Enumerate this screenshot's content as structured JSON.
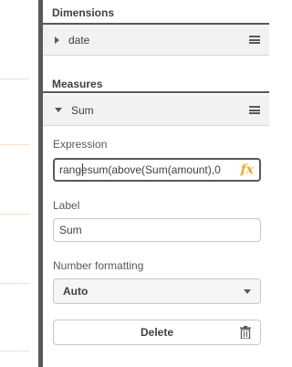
{
  "dimensions": {
    "title": "Dimensions",
    "items": [
      {
        "label": "date"
      }
    ]
  },
  "measures": {
    "title": "Measures",
    "items": [
      {
        "label": "Sum"
      }
    ]
  },
  "expression": {
    "label": "Expression",
    "value": "rangesum(above(Sum(amount),0",
    "fx_icon": "fx"
  },
  "label_field": {
    "label": "Label",
    "value": "Sum"
  },
  "number_formatting": {
    "label": "Number formatting",
    "selected": "Auto"
  },
  "delete_button": {
    "label": "Delete"
  },
  "colors": {
    "accent_fx": "#f5a623",
    "panel_rule": "#595959",
    "header_bg": "#f2f2f2"
  },
  "icons": [
    "hamburger-menu-icon",
    "caret-right-icon",
    "caret-down-icon",
    "fx-icon",
    "dropdown-arrow-icon",
    "trash-icon"
  ]
}
